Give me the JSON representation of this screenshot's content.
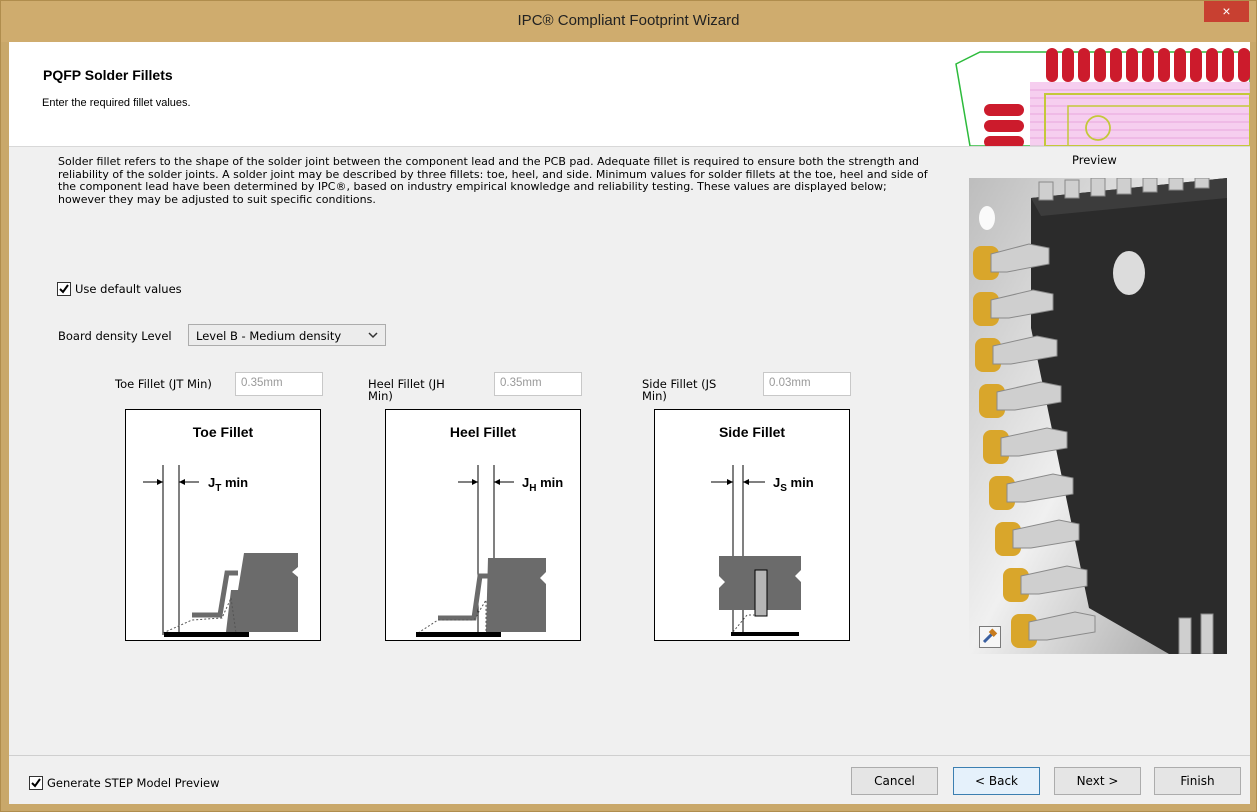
{
  "window": {
    "title": "IPC® Compliant Footprint Wizard",
    "close_glyph": "×"
  },
  "header": {
    "title": "PQFP Solder Fillets",
    "subtitle": "Enter the required fillet values."
  },
  "description": "Solder fillet refers to the shape of the solder joint between the component lead and the PCB pad. Adequate fillet is required to ensure both the strength and reliability of the solder joints. A solder joint may be described by three fillets: toe, heel, and side. Minimum values for solder fillets at the toe, heel and side of the component lead have been determined by IPC®, based on industry empirical knowledge and reliability testing. These values are displayed below; however they may be adjusted to suit specific conditions.",
  "use_default": {
    "label": "Use default values",
    "checked": true
  },
  "density": {
    "label": "Board density Level",
    "value": "Level B - Medium density"
  },
  "fillets": [
    {
      "label": "Toe Fillet (JT Min)",
      "value": "0.35mm",
      "diagram_title": "Toe Fillet",
      "sym_main": "J",
      "sym_sub": "T",
      "sym_suffix": " min"
    },
    {
      "label": "Heel Fillet (JH Min)",
      "value": "0.35mm",
      "diagram_title": "Heel Fillet",
      "sym_main": "J",
      "sym_sub": "H",
      "sym_suffix": " min"
    },
    {
      "label": "Side Fillet (JS Min)",
      "value": "0.03mm",
      "diagram_title": "Side Fillet",
      "sym_main": "J",
      "sym_sub": "S",
      "sym_suffix": " min"
    }
  ],
  "preview": {
    "label": "Preview",
    "tool_icon": "hammer-icon"
  },
  "footer": {
    "step_preview": {
      "label": "Generate STEP Model Preview",
      "checked": true
    },
    "buttons": {
      "cancel": "Cancel",
      "back": "< Back",
      "next": "Next >",
      "finish": "Finish"
    }
  },
  "colors": {
    "title_bar": "#cfac6e",
    "close": "#c84031",
    "pad": "#d9a62b",
    "pcb_red": "#cc1b2c"
  }
}
